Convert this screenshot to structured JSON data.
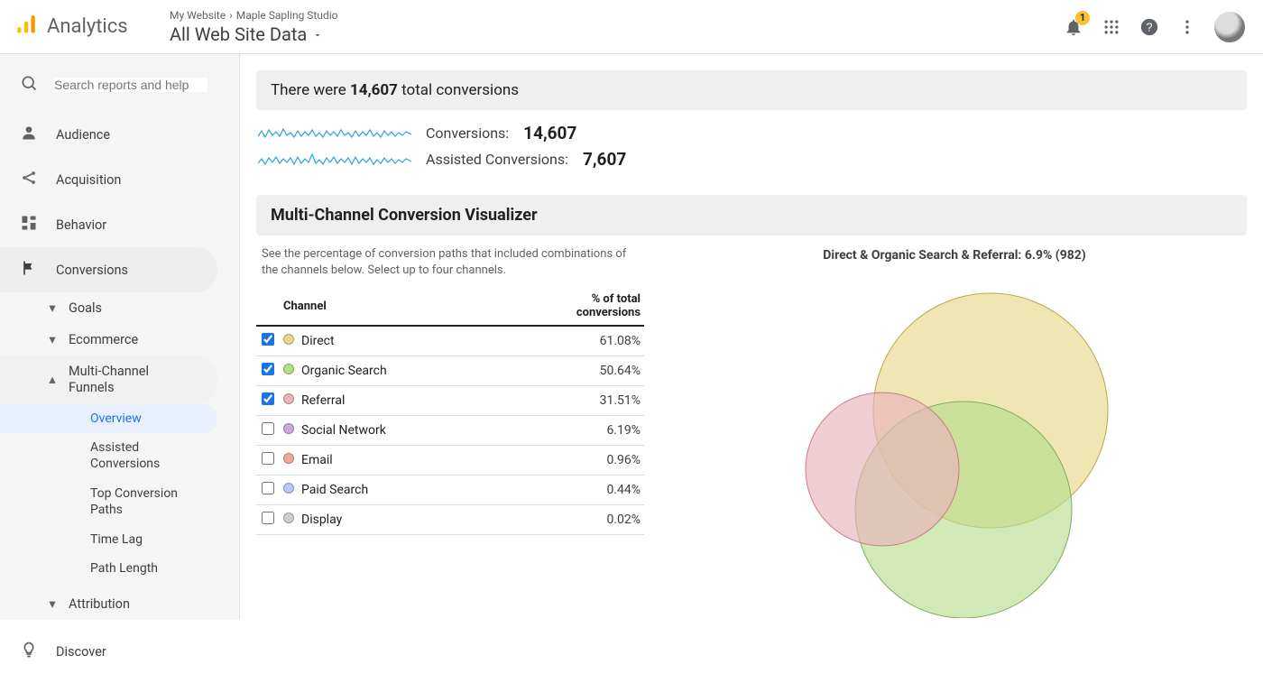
{
  "header": {
    "product": "Analytics",
    "crumb1": "My Website",
    "crumb2": "Maple Sapling Studio",
    "view": "All Web Site Data",
    "notification_count": "1"
  },
  "search": {
    "placeholder": "Search reports and help"
  },
  "nav": {
    "audience": "Audience",
    "acquisition": "Acquisition",
    "behavior": "Behavior",
    "conversions": "Conversions",
    "goals": "Goals",
    "ecommerce": "Ecommerce",
    "mcf": "Multi-Channel Funnels",
    "mcf_items": {
      "overview": "Overview",
      "assisted": "Assisted Conversions",
      "paths": "Top Conversion Paths",
      "timelag": "Time Lag",
      "pathlen": "Path Length"
    },
    "attribution": "Attribution",
    "discover": "Discover"
  },
  "banner": {
    "prefix": "There were ",
    "count": "14,607",
    "suffix": " total conversions"
  },
  "metrics": {
    "conv_label": "Conversions: ",
    "conv_value": "14,607",
    "assist_label": "Assisted Conversions: ",
    "assist_value": "7,607"
  },
  "visualizer": {
    "title": "Multi-Channel Conversion Visualizer",
    "desc": "See the percentage of conversion paths that included combinations of the channels below. Select up to four channels.",
    "col_channel": "Channel",
    "col_pct_l1": "% of total",
    "col_pct_l2": "conversions",
    "venn_title": "Direct & Organic Search & Referral: 6.9% (982)"
  },
  "channels": [
    {
      "name": "Direct",
      "pct": "61.08%",
      "checked": true,
      "color": "#e6d98a"
    },
    {
      "name": "Organic Search",
      "pct": "50.64%",
      "checked": true,
      "color": "#b7dd8f"
    },
    {
      "name": "Referral",
      "pct": "31.51%",
      "checked": true,
      "color": "#e7b4bb"
    },
    {
      "name": "Social Network",
      "pct": "6.19%",
      "checked": false,
      "color": "#c9a9d9"
    },
    {
      "name": "Email",
      "pct": "0.96%",
      "checked": false,
      "color": "#f2a6a0"
    },
    {
      "name": "Paid Search",
      "pct": "0.44%",
      "checked": false,
      "color": "#b9c9ef"
    },
    {
      "name": "Display",
      "pct": "0.02%",
      "checked": false,
      "color": "#cfcfcf"
    }
  ],
  "chart_data": {
    "type": "table",
    "title": "Multi-Channel Conversion Visualizer",
    "note": "Venn diagram of selected channels; percentages relative to 14,607 total conversions",
    "categories": [
      "Direct",
      "Organic Search",
      "Referral",
      "Social Network",
      "Email",
      "Paid Search",
      "Display"
    ],
    "values_pct": [
      61.08,
      50.64,
      31.51,
      6.19,
      0.96,
      0.44,
      0.02
    ],
    "selected": [
      "Direct",
      "Organic Search",
      "Referral"
    ],
    "triple_overlap": {
      "label": "Direct & Organic Search & Referral",
      "pct": 6.9,
      "count": 982
    },
    "totals": {
      "conversions": 14607,
      "assisted_conversions": 7607
    }
  }
}
